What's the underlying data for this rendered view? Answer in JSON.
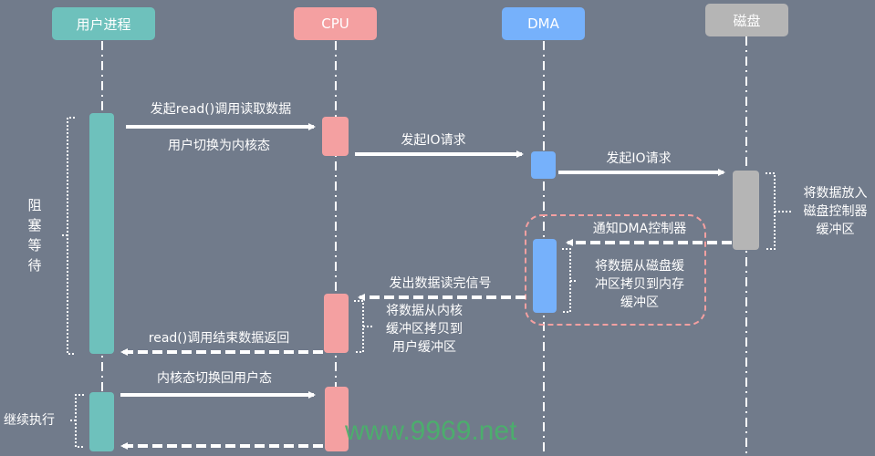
{
  "colors": {
    "background": "#717b8b",
    "user_process": "#6ec1bc",
    "cpu": "#f4a0a1",
    "dma": "#76b1fb",
    "disk": "#b5b5b5",
    "dma_frame": "#f4a0a1",
    "arrow": "#ffffff",
    "watermark": "#49b36a"
  },
  "participants": [
    {
      "id": "user",
      "label": "用户进程"
    },
    {
      "id": "cpu",
      "label": "CPU"
    },
    {
      "id": "dma",
      "label": "DMA"
    },
    {
      "id": "disk",
      "label": "磁盘"
    }
  ],
  "messages": [
    {
      "from": "user",
      "to": "cpu",
      "label": "发起read()调用读取数据",
      "style": "solid"
    },
    {
      "from": "cpu",
      "to": "cpu",
      "label": "用户切换为内核态",
      "style": "note"
    },
    {
      "from": "cpu",
      "to": "dma",
      "label": "发起IO请求",
      "style": "solid"
    },
    {
      "from": "dma",
      "to": "disk",
      "label": "发起IO请求",
      "style": "solid"
    },
    {
      "from": "disk",
      "to": "dma",
      "label": "通知DMA控制器",
      "style": "dashed"
    },
    {
      "from": "dma",
      "to": "cpu",
      "label": "发出数据读完信号",
      "style": "dashed"
    },
    {
      "from": "cpu",
      "to": "user",
      "label": "read()调用结束数据返回",
      "style": "dashed"
    },
    {
      "from": "user",
      "to": "cpu",
      "label": "内核态切换回用户态",
      "style": "solid"
    },
    {
      "from": "cpu",
      "to": "user",
      "label": "",
      "style": "dashed"
    }
  ],
  "notes": {
    "blocking_wait": "阻塞等待",
    "continue_exec": "继续执行",
    "disk_note": "将数据放入磁盘控制器缓冲区",
    "disk_note_lines": [
      "将数据放入",
      "磁盘控制器",
      "缓冲区"
    ],
    "dma_note_lines": [
      "将数据从磁盘缓",
      "冲区拷贝到内存",
      "缓冲区"
    ],
    "cpu_note_lines": [
      "将数据从内核",
      "缓冲区拷贝到",
      "用户缓冲区"
    ]
  },
  "watermark": "www.9969.net"
}
